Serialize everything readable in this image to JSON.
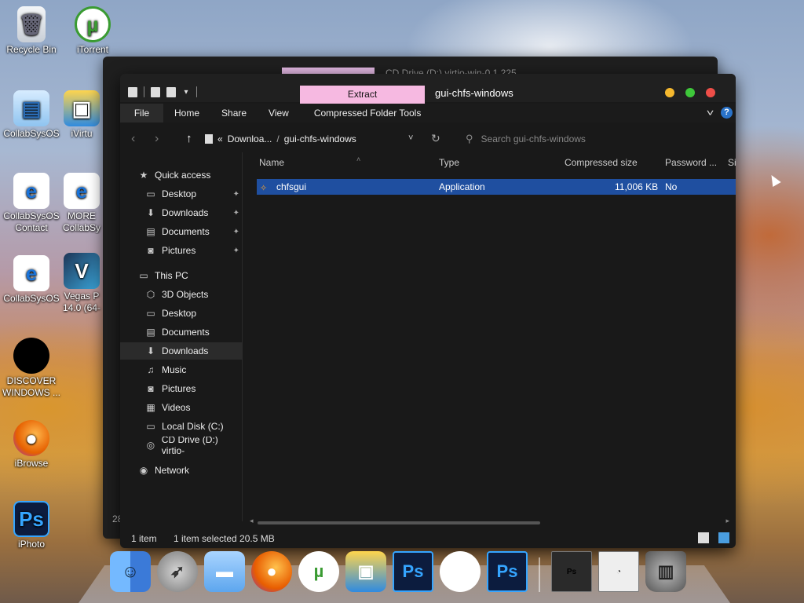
{
  "desktop": {
    "icons": [
      {
        "label": "Recycle Bin",
        "glyph": "🗑"
      },
      {
        "label": "iTorrent",
        "glyph": "µ"
      },
      {
        "label": "CollabSysOS",
        "glyph": "▤"
      },
      {
        "label": "iVirtu",
        "glyph": "▣"
      },
      {
        "label": "CollabSysOS Contact",
        "glyph": "e"
      },
      {
        "label": "MORE CollabSy",
        "glyph": "e"
      },
      {
        "label": "CollabSysOS",
        "glyph": "e"
      },
      {
        "label": "Vegas P 14.0 (64-",
        "glyph": "V"
      },
      {
        "label": "DISCOVER WINDOWS ...",
        "glyph": ""
      },
      {
        "label": "iBrowse",
        "glyph": "●"
      },
      {
        "label": "iPhoto",
        "glyph": "Ps"
      }
    ]
  },
  "background_window": {
    "title": "CD Drive (D:) virtio-win-0.1.225",
    "item_count": "28"
  },
  "explorer": {
    "context_tab": "Extract",
    "title": "gui-chfs-windows",
    "ribbon_tabs": [
      "File",
      "Home",
      "Share",
      "View",
      "Compressed Folder Tools"
    ],
    "address": {
      "prefix": "«",
      "crumbs": [
        "Downloa...",
        "gui-chfs-windows"
      ],
      "separator": "/"
    },
    "search_placeholder": "Search gui-chfs-windows",
    "nav": {
      "quick_access": "Quick access",
      "quick_items": [
        "Desktop",
        "Downloads",
        "Documents",
        "Pictures"
      ],
      "this_pc": "This PC",
      "pc_items": [
        "3D Objects",
        "Desktop",
        "Documents",
        "Downloads",
        "Music",
        "Pictures",
        "Videos",
        "Local Disk (C:)",
        "CD Drive (D:) virtio-"
      ],
      "network": "Network",
      "selected": "Downloads"
    },
    "columns": [
      "Name",
      "Type",
      "Compressed size",
      "Password ...",
      "Si"
    ],
    "rows": [
      {
        "name": "chfsgui",
        "type": "Application",
        "compressed_size": "11,006 KB",
        "password": "No"
      }
    ],
    "status": {
      "count": "1 item",
      "selection": "1 item selected  20.5 MB"
    }
  },
  "dock": {
    "items": [
      "Finder",
      "Launchpad",
      "Files",
      "Firefox",
      "uTorrent",
      "VirtualBox",
      "Photoshop",
      "Apple",
      "Photoshop"
    ],
    "minimized": [
      "Ps",
      "Firefox"
    ],
    "trash": "Trash"
  },
  "colors": {
    "selection": "#1f4fa0",
    "context_tab": "#f6b9e1",
    "window_bg": "#191919"
  }
}
